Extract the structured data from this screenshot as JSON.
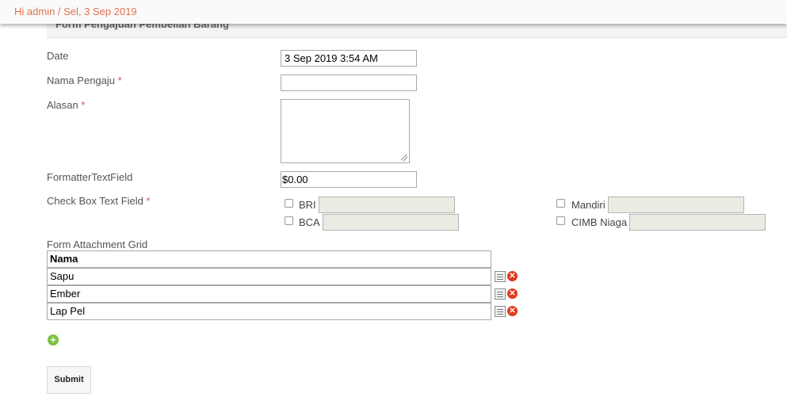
{
  "header": {
    "greeting": "Hi admin / Sel, 3 Sep 2019"
  },
  "form": {
    "title": "Form Pengajuan Pembelian Barang",
    "required_mark": "*",
    "fields": {
      "date": {
        "label": "Date",
        "value": "3 Sep 2019 3:54 AM"
      },
      "nama_pengaju": {
        "label": "Nama Pengaju",
        "value": ""
      },
      "alasan": {
        "label": "Alasan",
        "value": ""
      },
      "formatter": {
        "label": "FormatterTextField",
        "value": "$0.00"
      },
      "checkbox_group": {
        "label": "Check Box Text Field",
        "options": [
          {
            "label": "BRI",
            "checked": false
          },
          {
            "label": "Mandiri",
            "checked": false
          },
          {
            "label": "BCA",
            "checked": false
          },
          {
            "label": "CIMB Niaga",
            "checked": false
          }
        ]
      }
    },
    "grid": {
      "label": "Form Attachment Grid",
      "header": "Nama",
      "rows": [
        "Sapu",
        "Ember",
        "Lap Pel"
      ]
    },
    "submit_label": "Submit"
  },
  "icons": {
    "edit": "edit-row-icon",
    "delete": "delete-row-icon",
    "add": "add-row-icon"
  },
  "colors": {
    "greeting": "#e2704c",
    "required": "#d9534f",
    "delete": "#e03a1e",
    "add": "#7cc242"
  }
}
